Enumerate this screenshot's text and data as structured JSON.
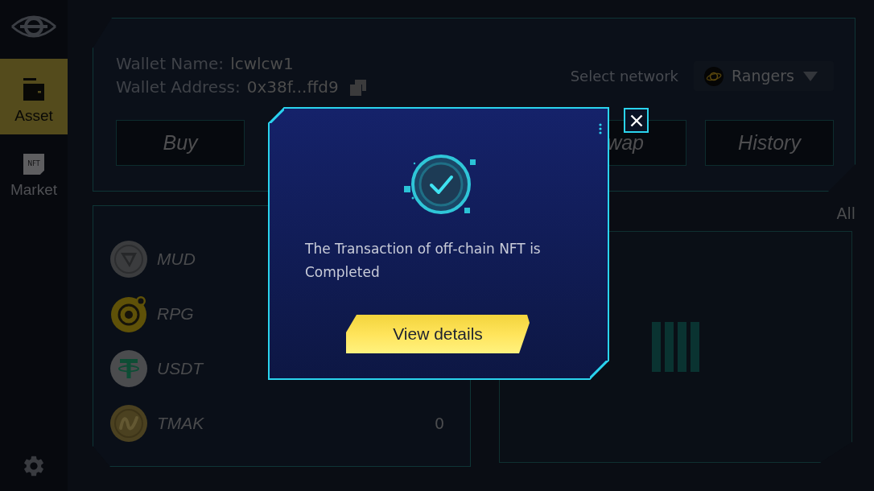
{
  "sidebar": {
    "items": [
      {
        "label": "Asset",
        "selected": true
      },
      {
        "label": "Market",
        "badge": "NFT",
        "selected": false
      }
    ]
  },
  "wallet": {
    "name_label": "Wallet Name:",
    "name": "lcwlcw1",
    "address_label": "Wallet Address:",
    "address": "0x38f...ffd9"
  },
  "network": {
    "label": "Select network",
    "value": "Rangers"
  },
  "actions": [
    {
      "kind": "full",
      "label": "Buy"
    },
    {
      "kind": "hidden"
    },
    {
      "kind": "hidden"
    },
    {
      "kind": "cut",
      "label": "wap"
    },
    {
      "kind": "full",
      "label": "History"
    }
  ],
  "assets": {
    "rows": [
      {
        "name": "MUD"
      },
      {
        "name": "RPG"
      },
      {
        "name": "USDT"
      },
      {
        "name": "TMAK",
        "amount": "0"
      }
    ]
  },
  "nfts": {
    "filter": "All"
  },
  "dialog": {
    "message": "The Transaction of off-chain NFT is Completed",
    "button": "View details"
  }
}
